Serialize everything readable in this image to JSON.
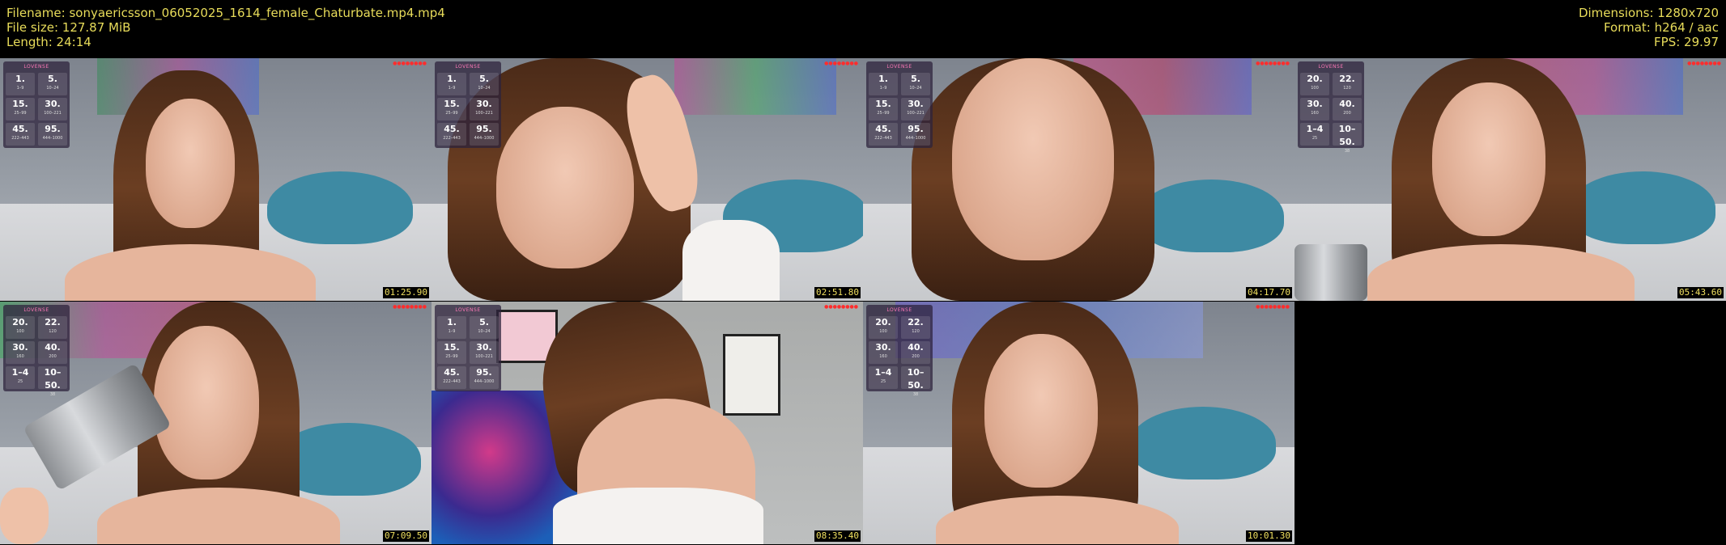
{
  "header": {
    "filename": "Filename: sonyaericsson_06052025_1614_female_Chaturbate.mp4.mp4",
    "filesize": "File size: 127.87 MiB",
    "length": "Length: 24:14",
    "dimensions": "Dimensions: 1280x720",
    "format": "Format: h264 / aac",
    "fps": "FPS: 29.97"
  },
  "overlay_brand": "LOVENSE",
  "overlay_a": {
    "rows": [
      [
        {
          "big": "1.",
          "small": "1–9"
        },
        {
          "big": "5.",
          "small": "10–24"
        }
      ],
      [
        {
          "big": "15.",
          "small": "25–99"
        },
        {
          "big": "30.",
          "small": "100–221"
        }
      ],
      [
        {
          "big": "45.",
          "small": "222–443"
        },
        {
          "big": "95.",
          "small": "444–1000"
        }
      ]
    ]
  },
  "overlay_b": {
    "rows": [
      [
        {
          "big": "20.",
          "small": "100"
        },
        {
          "big": "22.",
          "small": "120"
        }
      ],
      [
        {
          "big": "30.",
          "small": "160"
        },
        {
          "big": "40.",
          "small": "200"
        }
      ],
      [
        {
          "big": "1–4",
          "small": "25"
        },
        {
          "big": "10–50.",
          "small": "38"
        }
      ]
    ]
  },
  "thumbnails": [
    {
      "timestamp": "01:25.90"
    },
    {
      "timestamp": "02:51.80"
    },
    {
      "timestamp": "04:17.70"
    },
    {
      "timestamp": "05:43.60"
    },
    {
      "timestamp": "07:09.50"
    },
    {
      "timestamp": "08:35.40"
    },
    {
      "timestamp": "10:01.30"
    }
  ]
}
